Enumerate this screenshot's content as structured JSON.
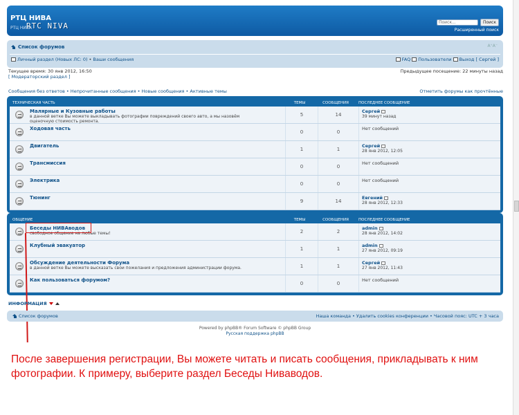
{
  "header": {
    "site_title": "РТЦ НИВА",
    "logo_text": "RTC NIVA",
    "site_desc": "РТЦ НИВА",
    "search_placeholder": "Поиск...",
    "search_button": "Поиск",
    "advanced_search": "Расширенный поиск"
  },
  "nav": {
    "forum_index": "Список форумов",
    "user_panel": "Личный раздел (Новых ЛС: 0)",
    "sep": "•",
    "your_posts": "Ваши сообщения",
    "faq": "FAQ",
    "members": "Пользователи",
    "logout": "Выход [ Сергей ]"
  },
  "info": {
    "current_time": "Текущее время: 30 янв 2012, 16:50",
    "mod_section": "[ Модераторский раздел ]",
    "last_visit": "Предыдущее посещение: 22 минуты назад",
    "quick_links": "Сообщения без ответов • Непрочитанные сообщения • Новые сообщения • Активные темы",
    "mark_read": "Отметить форумы как прочтённые"
  },
  "columns": {
    "topics": "ТЕМЫ",
    "posts": "СООБЩЕНИЯ",
    "last_post": "ПОСЛЕДНЕЕ СООБЩЕНИЕ"
  },
  "categories": [
    {
      "title": "ТЕХНИЧЕСКАЯ ЧАСТЬ",
      "forums": [
        {
          "name": "Малярные и Кузовные работы",
          "desc": "в данной ветке Вы можете выкладывать фотографии повреждений своего авто, а мы назовём оценочную стоимость ремонта.",
          "topics": "5",
          "posts": "14",
          "last_author": "Сергей",
          "last_time": "39 минут назад",
          "no_posts": ""
        },
        {
          "name": "Ходовая часть",
          "desc": "",
          "topics": "0",
          "posts": "0",
          "last_author": "",
          "last_time": "",
          "no_posts": "Нет сообщений"
        },
        {
          "name": "Двигатель",
          "desc": "",
          "topics": "1",
          "posts": "1",
          "last_author": "Сергей",
          "last_time": "28 янв 2012, 12:05",
          "no_posts": ""
        },
        {
          "name": "Трансмиссия",
          "desc": "",
          "topics": "0",
          "posts": "0",
          "last_author": "",
          "last_time": "",
          "no_posts": "Нет сообщений"
        },
        {
          "name": "Электрика",
          "desc": "",
          "topics": "0",
          "posts": "0",
          "last_author": "",
          "last_time": "",
          "no_posts": "Нет сообщений"
        },
        {
          "name": "Тюнинг",
          "desc": "",
          "topics": "9",
          "posts": "14",
          "last_author": "Евгений",
          "last_time": "28 янв 2012, 12:33",
          "no_posts": ""
        }
      ]
    },
    {
      "title": "ОБЩЕНИЕ",
      "forums": [
        {
          "name": "Беседы НИВАводов",
          "desc": "свободное общение на любые темы!",
          "topics": "2",
          "posts": "2",
          "last_author": "admin",
          "last_time": "28 янв 2012, 14:02",
          "no_posts": ""
        },
        {
          "name": "Клубный эвакуатор",
          "desc": "",
          "topics": "1",
          "posts": "1",
          "last_author": "admin",
          "last_time": "27 янв 2012, 09:19",
          "no_posts": ""
        },
        {
          "name": "Обсуждение деятельности Форума",
          "desc": "в данной ветке Вы можете высказать свои пожелания и предложения администрации форума.",
          "topics": "1",
          "posts": "1",
          "last_author": "Сергей",
          "last_time": "27 янв 2012, 11:43",
          "no_posts": ""
        },
        {
          "name": "Как пользоваться форумом?",
          "desc": "",
          "topics": "0",
          "posts": "0",
          "last_author": "",
          "last_time": "",
          "no_posts": "Нет сообщений"
        }
      ]
    }
  ],
  "information_label": "ИНФОРМАЦИЯ",
  "footer": {
    "forum_index": "Список форумов",
    "right": "Наша команда • Удалить cookies конференции • Часовой пояс: UTC + 3 часа",
    "copyright": "Powered by phpBB® Forum Software © phpBB Group",
    "support": "Русская поддержка phpBB"
  },
  "annotation": "После завершения регистрации, Вы можете читать и писать сообщения, прикладывать к ним фотографии. К примеру, выберите раздел Беседы Ниваводов."
}
